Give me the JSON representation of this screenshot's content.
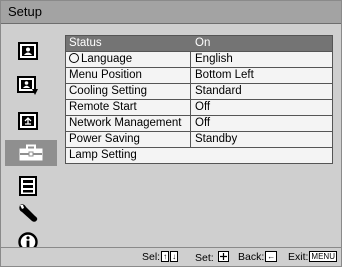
{
  "window": {
    "title": "Setup"
  },
  "sidebar": {
    "icons": [
      {
        "name": "picture-icon"
      },
      {
        "name": "picture-advanced-icon"
      },
      {
        "name": "screen-icon"
      },
      {
        "name": "setup-icon",
        "active": true
      },
      {
        "name": "menu-setting-icon"
      },
      {
        "name": "wrench-icon"
      },
      {
        "name": "info-icon"
      }
    ]
  },
  "menu": {
    "rows": [
      {
        "label": "Status",
        "value": "On",
        "selected": true
      },
      {
        "label": "Language",
        "value": "English",
        "icon": "globe-icon"
      },
      {
        "label": "Menu Position",
        "value": "Bottom Left"
      },
      {
        "label": "Cooling Setting",
        "value": "Standard"
      },
      {
        "label": "Remote Start",
        "value": "Off"
      },
      {
        "label": "Network Management",
        "value": "Off"
      },
      {
        "label": "Power Saving",
        "value": "Standby"
      },
      {
        "label": "Lamp Setting",
        "value": ""
      }
    ]
  },
  "footer": {
    "sel_label": "Sel:",
    "sel_keys": [
      "↑",
      "↓"
    ],
    "set_label": "Set:",
    "back_label": "Back:",
    "back_key": "←",
    "exit_label": "Exit:",
    "exit_key": "MENU"
  },
  "colors": {
    "selected_row": "#747474",
    "title_bar": "#a3a3a3",
    "background": "#cfcfcf"
  }
}
